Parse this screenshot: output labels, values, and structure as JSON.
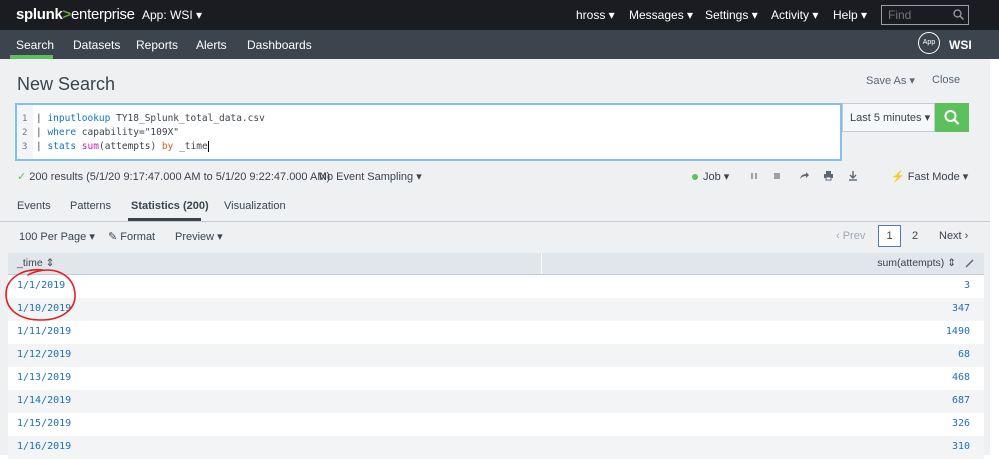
{
  "topbar": {
    "logo_brand": "splunk",
    "logo_gt": ">",
    "logo_product": "enterprise",
    "app_menu": "App: WSI ▾",
    "user_menu": "hross ▾",
    "messages_menu": "Messages ▾",
    "settings_menu": "Settings ▾",
    "activity_menu": "Activity ▾",
    "help_menu": "Help ▾",
    "find_placeholder": "Find"
  },
  "nav": {
    "items": [
      "Search",
      "Datasets",
      "Reports",
      "Alerts",
      "Dashboards"
    ],
    "app_badge": "App",
    "app_name": "WSI"
  },
  "search": {
    "title": "New Search",
    "save_as": "Save As ▾",
    "close": "Close",
    "lines": [
      {
        "num": "1",
        "pipe": "| ",
        "cmd": "inputlookup",
        "rest": " TY18_Splunk_total_data.csv"
      },
      {
        "num": "2",
        "pipe": "| ",
        "cmd": "where",
        "rest": " capability=\"109X\""
      },
      {
        "num": "3",
        "pipe": "| ",
        "cmd": "stats",
        "fn": "sum",
        "args": "(attempts) ",
        "by": "by",
        "tail": " _time"
      }
    ],
    "time_range": "Last 5 minutes ▾"
  },
  "results": {
    "summary": "200 results (5/1/20 9:17:47.000 AM to 5/1/20 9:22:47.000 AM)",
    "sampling": "No Event Sampling ▾",
    "job": "Job ▾",
    "fast_mode": "Fast Mode ▾"
  },
  "tabs": [
    "Events",
    "Patterns",
    "Statistics (200)",
    "Visualization"
  ],
  "toolbar": {
    "per_page": "100 Per Page ▾",
    "format": "Format",
    "preview": "Preview ▾",
    "prev": "‹ Prev",
    "page1": "1",
    "page2": "2",
    "next": "Next ›"
  },
  "table": {
    "col_time": "_time ⇕",
    "col_sum": "sum(attempts) ⇕",
    "rows": [
      {
        "time": "1/1/2019",
        "sum": "3"
      },
      {
        "time": "1/10/2019",
        "sum": "347"
      },
      {
        "time": "1/11/2019",
        "sum": "1490"
      },
      {
        "time": "1/12/2019",
        "sum": "68"
      },
      {
        "time": "1/13/2019",
        "sum": "468"
      },
      {
        "time": "1/14/2019",
        "sum": "687"
      },
      {
        "time": "1/15/2019",
        "sum": "326"
      },
      {
        "time": "1/16/2019",
        "sum": "310"
      }
    ]
  },
  "colors": {
    "topbar": "#1a1c21",
    "navbar": "#3c444d",
    "accent_green": "#5cc05c",
    "link_blue": "#1e6fba",
    "annotation_red": "#e02020"
  }
}
